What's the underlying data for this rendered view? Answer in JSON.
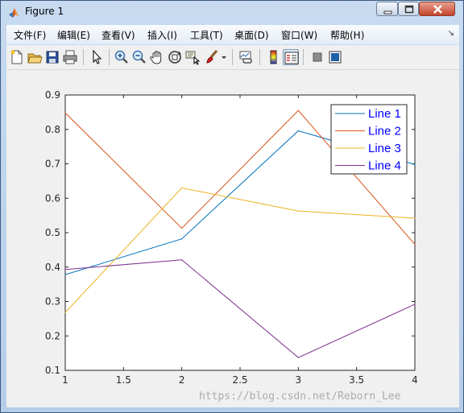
{
  "window": {
    "title": "Figure 1",
    "controls": [
      "minimize",
      "maximize",
      "close"
    ]
  },
  "menubar": {
    "items": [
      {
        "label": "文件(F)"
      },
      {
        "label": "编辑(E)"
      },
      {
        "label": "查看(V)"
      },
      {
        "label": "插入(I)"
      },
      {
        "label": "工具(T)"
      },
      {
        "label": "桌面(D)"
      },
      {
        "label": "窗口(W)"
      },
      {
        "label": "帮助(H)"
      }
    ],
    "overflow_icon": "dock-arrow-icon"
  },
  "toolbar": {
    "icons": [
      "new-figure-icon",
      "open-file-icon",
      "save-icon",
      "print-icon",
      "edit-plot-arrow-icon",
      "zoom-in-icon",
      "zoom-out-icon",
      "pan-hand-icon",
      "rotate-3d-icon",
      "data-cursor-icon",
      "brush-icon",
      "brush-dropdown-icon",
      "link-plot-icon",
      "colorbar-icon",
      "legend-icon",
      "hide-plot-tools-icon",
      "show-plot-tools-icon"
    ]
  },
  "watermark": "https://blog.csdn.net/Reborn_Lee",
  "chart_data": {
    "type": "line",
    "title": "",
    "xlabel": "",
    "ylabel": "",
    "xlim": [
      1,
      4
    ],
    "ylim": [
      0.1,
      0.9
    ],
    "xticks": [
      "1",
      "1.5",
      "2",
      "2.5",
      "3",
      "3.5",
      "4"
    ],
    "yticks": [
      "0.1",
      "0.2",
      "0.3",
      "0.4",
      "0.5",
      "0.6",
      "0.7",
      "0.8",
      "0.9"
    ],
    "grid": false,
    "legend_position": "top-right",
    "x": [
      1,
      2,
      3,
      4
    ],
    "series": [
      {
        "name": "Line 1",
        "color": "#0072bd",
        "values": [
          0.378,
          0.482,
          0.796,
          0.698
        ]
      },
      {
        "name": "Line 2",
        "color": "#d95319",
        "values": [
          0.848,
          0.513,
          0.855,
          0.466
        ]
      },
      {
        "name": "Line 3",
        "color": "#edb120",
        "values": [
          0.268,
          0.63,
          0.563,
          0.542
        ]
      },
      {
        "name": "Line 4",
        "color": "#7e2f8e",
        "values": [
          0.393,
          0.421,
          0.137,
          0.292
        ]
      }
    ]
  }
}
